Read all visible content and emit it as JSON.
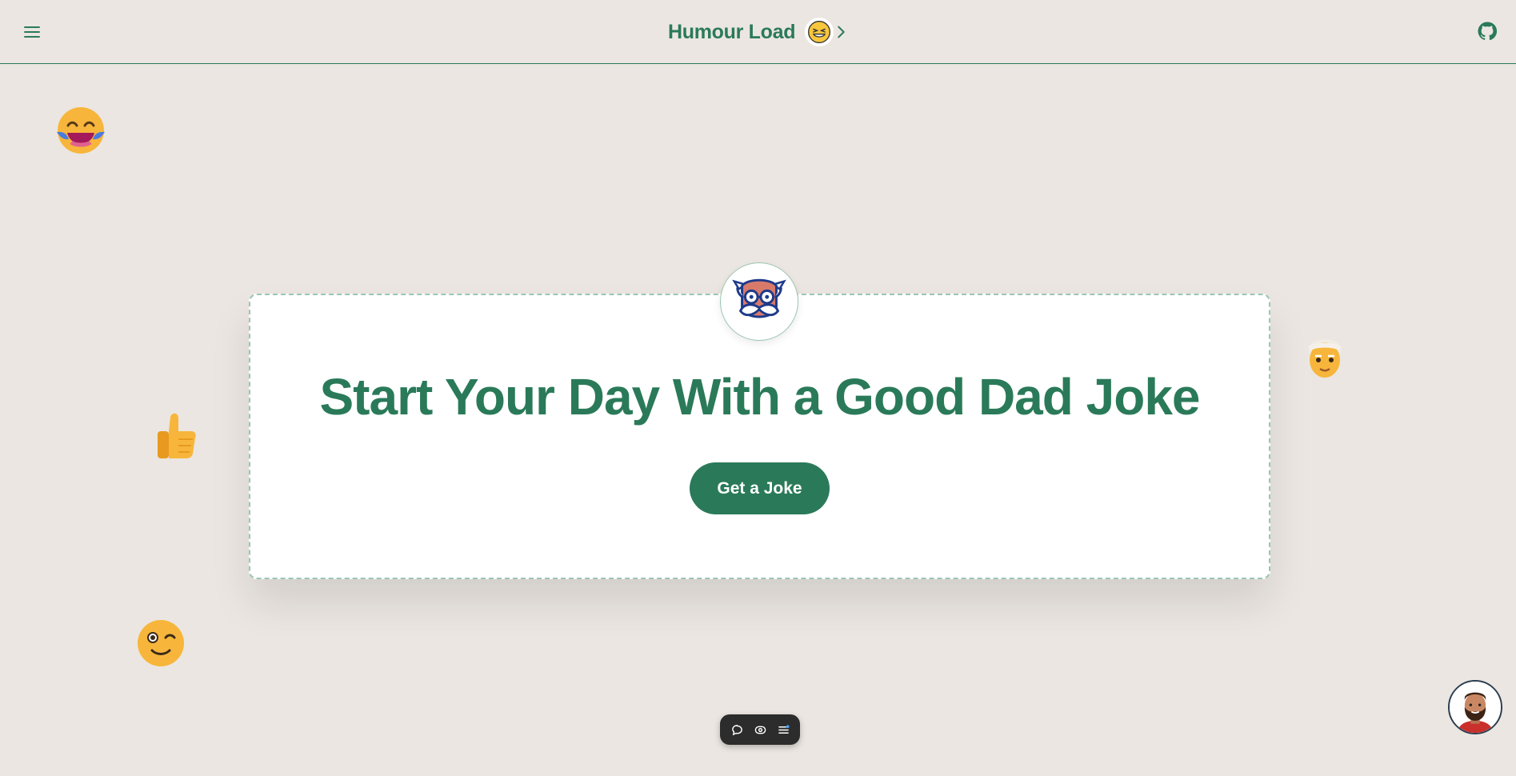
{
  "header": {
    "brand": "Humour Load",
    "menu_icon": "hamburger-menu-icon",
    "brand_emoji_icon": "grinning-squinting-face-icon",
    "next_icon": "chevron-right-icon",
    "github_icon": "github-icon"
  },
  "hero": {
    "headline": "Start Your Day With a Good Dad Joke",
    "cta_label": "Get a Joke",
    "avatar_icon": "dad-face-with-glasses-and-mustache-icon"
  },
  "decorations": [
    "face-with-tears-of-joy-icon",
    "thumbs-up-icon",
    "winking-face-icon",
    "old-man-icon"
  ],
  "toolbar": {
    "icons": [
      "comment-icon",
      "eye-icon",
      "list-icon"
    ]
  },
  "chat": {
    "avatar_icon": "bearded-man-avatar-icon"
  },
  "colors": {
    "accent": "#2a7a59",
    "background": "#ebe6e1",
    "card": "#ffffff",
    "toolbar": "#2c2c2c"
  }
}
